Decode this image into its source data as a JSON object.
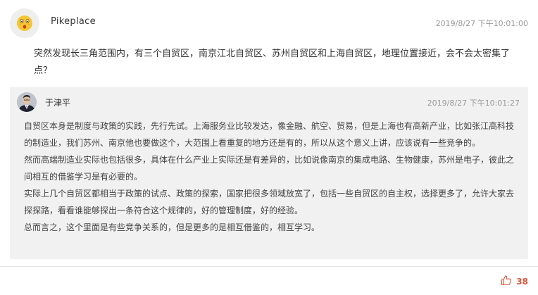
{
  "question": {
    "user": "Pikeplace",
    "time": "2019/8/27 下午10:01:00",
    "text": "突然发现长三角范围内，有三个自贸区，南京江北自贸区、苏州自贸区和上海自贸区，地理位置接近，会不会太密集了点？",
    "avatar_icon": "surprised-face-icon"
  },
  "reply": {
    "user": "于津平",
    "time": "2019/8/27 下午10:01:27",
    "avatar_icon": "user-photo-icon",
    "paragraphs": [
      "自贸区本身是制度与政策的实践，先行先试。上海服务业比较发达，像金融、航空、贸易，但是上海也有高新产业，比如张江高科技的制造业，我们苏州、南京他也要做这个，大范围上看重复的地方还是有的，所以从这个意义上讲，应该说有一些竞争的。",
      "然而高端制造业实际也包括很多，具体在什么产业上实际还是有差异的，比如说像南京的集成电路、生物健康，苏州是电子，彼此之间相互的借鉴学习是有必要的。",
      "实际上几个自贸区都相当于政策的试点、政策的探索，国家把很多领域放宽了，包括一些自贸区的自主权，选择更多了，允许大家去探探路，看看谁能够探出一条符合这个规律的，好的管理制度，好的经验。",
      "总而言之，这个里面是有些竞争关系的，但是更多的是相互借鉴的，相互学习。"
    ]
  },
  "like": {
    "count": "38",
    "icon": "thumbs-up-icon"
  },
  "colors": {
    "reply_background": "#f1f1f1",
    "like_accent": "#e0553d",
    "timestamp": "#9a9a9a"
  }
}
